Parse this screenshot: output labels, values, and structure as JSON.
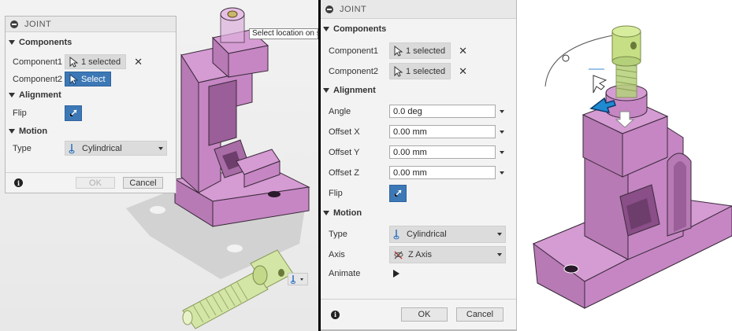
{
  "left_dialog": {
    "title": "JOINT",
    "components_header": "Components",
    "component1_label": "Component1",
    "component1_value": "1 selected",
    "component2_label": "Component2",
    "component2_value": "Select",
    "alignment_header": "Alignment",
    "flip_label": "Flip",
    "motion_header": "Motion",
    "type_label": "Type",
    "type_value": "Cylindrical",
    "ok_label": "OK",
    "cancel_label": "Cancel"
  },
  "tooltip": "Select location on se",
  "right_dialog": {
    "title": "JOINT",
    "components_header": "Components",
    "component1_label": "Component1",
    "component1_value": "1 selected",
    "component2_label": "Component2",
    "component2_value": "1 selected",
    "alignment_header": "Alignment",
    "angle_label": "Angle",
    "angle_value": "0.0 deg",
    "offset_x_label": "Offset X",
    "offset_x_value": "0.00 mm",
    "offset_y_label": "Offset Y",
    "offset_y_value": "0.00 mm",
    "offset_z_label": "Offset Z",
    "offset_z_value": "0.00 mm",
    "flip_label": "Flip",
    "motion_header": "Motion",
    "type_label": "Type",
    "type_value": "Cylindrical",
    "axis_label": "Axis",
    "axis_value": "Z Axis",
    "animate_label": "Animate",
    "ok_label": "OK",
    "cancel_label": "Cancel"
  },
  "colors": {
    "part_fill": "#c98ac8",
    "part_edge": "#3a2a3a",
    "bolt_fill": "#c2dc7c",
    "accent_blue": "#3c78b5",
    "arrow_cyan": "#1f8ad1"
  },
  "icons": [
    "minus-icon",
    "cursor-icon",
    "close-icon",
    "flip-icon",
    "cylindrical-joint-icon",
    "z-axis-icon",
    "play-icon",
    "info-icon",
    "dropdown-arrow-icon"
  ]
}
